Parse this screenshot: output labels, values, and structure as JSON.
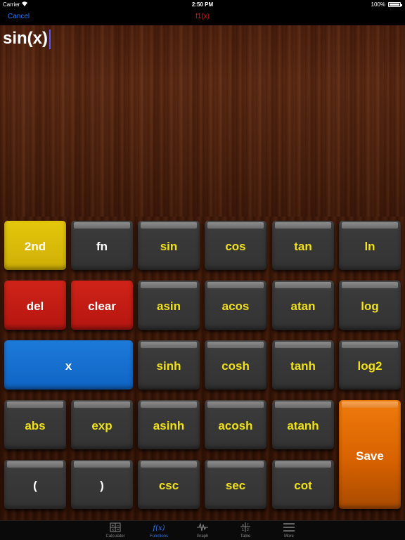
{
  "status_bar": {
    "carrier": "Carrier",
    "time": "2:50 PM",
    "battery": "100%"
  },
  "nav": {
    "cancel": "Cancel",
    "title": "f1(x)"
  },
  "display": {
    "expression": "sin(x)"
  },
  "keys": {
    "second": "2nd",
    "fn": "fn",
    "sin": "sin",
    "cos": "cos",
    "tan": "tan",
    "ln": "ln",
    "del": "del",
    "clear": "clear",
    "asin": "asin",
    "acos": "acos",
    "atan": "atan",
    "log": "log",
    "x": "x",
    "sinh": "sinh",
    "cosh": "cosh",
    "tanh": "tanh",
    "log2": "log2",
    "abs": "abs",
    "exp": "exp",
    "asinh": "asinh",
    "acosh": "acosh",
    "atanh": "atanh",
    "save": "Save",
    "lparen": "(",
    "rparen": ")",
    "csc": "csc",
    "sec": "sec",
    "cot": "cot"
  },
  "tabs": [
    {
      "label": "Calculator",
      "icon": "calculator-icon"
    },
    {
      "label": "Functions",
      "icon": "function-icon",
      "active": true
    },
    {
      "label": "Graph",
      "icon": "graph-icon"
    },
    {
      "label": "Table",
      "icon": "table-icon"
    },
    {
      "label": "More",
      "icon": "menu-icon"
    }
  ],
  "colors": {
    "accent": "#2f7bff",
    "title": "#e8131b",
    "key_text": "#f0e11a"
  }
}
